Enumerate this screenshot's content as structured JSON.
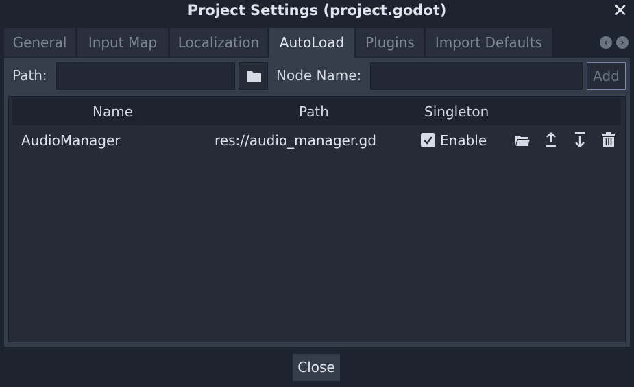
{
  "window": {
    "title": "Project Settings (project.godot)"
  },
  "tabs": [
    {
      "label": "General"
    },
    {
      "label": "Input Map"
    },
    {
      "label": "Localization"
    },
    {
      "label": "AutoLoad",
      "active": true
    },
    {
      "label": "Plugins"
    },
    {
      "label": "Import Defaults"
    }
  ],
  "form": {
    "path_label": "Path:",
    "path_value": "",
    "node_name_label": "Node Name:",
    "node_name_value": "",
    "add_label": "Add"
  },
  "table": {
    "columns": [
      "Name",
      "Path",
      "Singleton"
    ],
    "rows": [
      {
        "name": "AudioManager",
        "path": "res://audio_manager.gd",
        "singleton_label": "Enable",
        "singleton_enabled": true
      }
    ]
  },
  "footer": {
    "close_label": "Close"
  },
  "icons": {
    "window_close": "close-icon",
    "tab_prev": "chevron-left-icon",
    "tab_next": "chevron-right-icon",
    "browse": "folder-icon",
    "row_actions": [
      "folder-open-icon",
      "move-up-icon",
      "move-down-icon",
      "delete-icon"
    ]
  }
}
